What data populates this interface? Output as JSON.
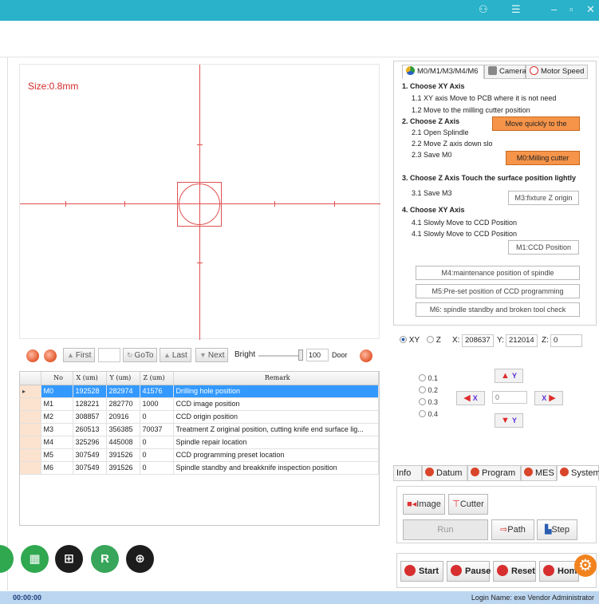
{
  "titlebar": {
    "user_icon": "user-icon",
    "menu_icon": "menu-icon",
    "minimize": "–",
    "maximize": "▫",
    "close": "✕"
  },
  "canvas": {
    "size_label": "Size:0.8mm",
    "accent": "#e05050"
  },
  "nav": {
    "first": "First",
    "goto": "GoTo",
    "last": "Last",
    "next": "Next",
    "bright_label": "Bright",
    "bright_value": "100",
    "door_label": "Door",
    "bright_level": 100
  },
  "table": {
    "columns": [
      "No",
      "X (um)",
      "Y (um)",
      "Z (um)",
      "Remark"
    ],
    "rows": [
      {
        "no": "M0",
        "x": "192528",
        "y": "282974",
        "z": "41576",
        "remark": "Drilling hole position",
        "selected": true
      },
      {
        "no": "M1",
        "x": "128221",
        "y": "282770",
        "z": "1000",
        "remark": "CCD image position"
      },
      {
        "no": "M2",
        "x": "308857",
        "y": "20916",
        "z": "0",
        "remark": "CCD origin position"
      },
      {
        "no": "M3",
        "x": "260513",
        "y": "356385",
        "z": "70037",
        "remark": "Treatment Z original position, cutting knife end surface lig..."
      },
      {
        "no": "M4",
        "x": "325296",
        "y": "445008",
        "z": "0",
        "remark": "Spindle repair location"
      },
      {
        "no": "M5",
        "x": "307549",
        "y": "391526",
        "z": "0",
        "remark": "CCD programming preset location"
      },
      {
        "no": "M6",
        "x": "307549",
        "y": "391526",
        "z": "0",
        "remark": "Spindle standby and breakknife inspection position"
      }
    ]
  },
  "bottom_icons": [
    {
      "name": "table-icon",
      "glyph": "▦",
      "color": "#2fa84f"
    },
    {
      "name": "board-icon",
      "glyph": "⊞",
      "color": "#1d1d1d"
    },
    {
      "name": "grid-r-icon",
      "glyph": "R",
      "color": "#37a65a"
    },
    {
      "name": "origin-icon",
      "glyph": "⊕",
      "color": "#1d1d1d"
    }
  ],
  "tabs": {
    "t1": "M0/M1/M3/M4/M6",
    "t2": "Camera",
    "t3": "Motor Speed"
  },
  "steps": {
    "s1": "1. Choose XY Axis",
    "s1_1": "1.1  XY axis Move to PCB where it is not need",
    "s1_2": "1.2 Move to the milling cutter position",
    "s2": "2. Choose Z Axis",
    "s2_1": "2.1 Open Splindle",
    "s2_2": "2.2 Move Z axis down slo",
    "s2_3": "2.3 Save M0",
    "btn_move": "Move quickly to the",
    "btn_m0": "M0:Milling cutter",
    "s3": "3. Choose Z Axis Touch the surface position lightly",
    "s3_1": "3.1 Save M3",
    "btn_m3": "M3:fixture Z origin",
    "s4": "4. Choose XY Axis",
    "s4_1": "4.1 Slowly Move to CCD Position",
    "s4_2": "4.1 Slowly Move to CCD Position",
    "btn_m1": "M1:CCD Position",
    "btn_m4": "M4:maintenance position of spindle",
    "btn_m5": "M5:Pre-set position of CCD programming",
    "btn_m6": "M6: spindle standby and broken tool check"
  },
  "coords": {
    "xy": "XY",
    "z": "Z",
    "x_label": "X:",
    "x_value": "208637",
    "y_label": "Y:",
    "y_value": "212014",
    "z_label": "Z:",
    "z_value": "0"
  },
  "jog": {
    "steps": [
      "0.1",
      "0.2",
      "0.3",
      "0.4"
    ],
    "up": "Y",
    "down": "Y",
    "left": "X",
    "right": "X",
    "value": "0"
  },
  "bottom_tabs": {
    "info": "Info",
    "datum": "Datum",
    "program": "Program",
    "mes": "MES",
    "system": "System"
  },
  "system": {
    "image": "Image",
    "cutter": "Cutter",
    "run": "Run",
    "path": "Path",
    "step": "Step"
  },
  "controls": {
    "start": "Start",
    "pause": "Pause",
    "reset": "Reset",
    "home": "Home"
  },
  "status": {
    "time": "00:00:00",
    "login": "Login Name: exe Vendor Administrator"
  }
}
